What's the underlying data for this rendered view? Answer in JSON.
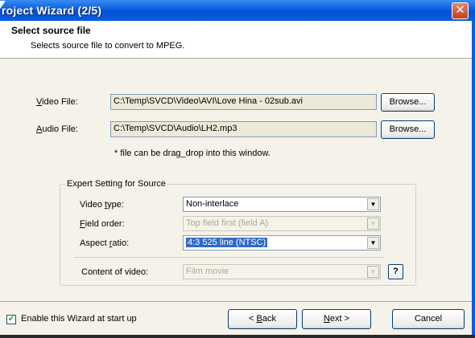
{
  "window": {
    "title": "roject Wizard (2/5)",
    "close_glyph": "✕"
  },
  "header": {
    "title": "Select source file",
    "subtitle": "Selects source file to convert to MPEG."
  },
  "video": {
    "label_key": "V",
    "label_rest": "ideo File:",
    "path": "C:\\Temp\\SVCD\\Video\\AVI\\Love Hina - 02sub.avi",
    "browse": "Browse..."
  },
  "audio": {
    "label_key": "A",
    "label_rest": "udio File:",
    "path": "C:\\Temp\\SVCD\\Audio\\LH2.mp3",
    "browse": "Browse..."
  },
  "note": "* file can be drag_drop into this window.",
  "expert": {
    "legend": "Expert Setting for Source",
    "video_type": {
      "label_pre": "Video ",
      "label_key": "t",
      "label_post": "ype:",
      "value": "Non-interlace"
    },
    "field_order": {
      "label_key": "F",
      "label_post": "ield order:",
      "value": "Top field first (field A)"
    },
    "aspect_ratio": {
      "label_pre": "Aspect ",
      "label_key": "r",
      "label_post": "atio:",
      "value": "4:3 525 line (NTSC)"
    },
    "content": {
      "label": "Content of video:",
      "value": "Film movie"
    },
    "help": "?"
  },
  "footer": {
    "checkbox_label": "Enable this Wizard at start up",
    "checkbox_checked": true,
    "check_glyph": "✔",
    "back_prefix": "< ",
    "back_key": "B",
    "back_rest": "ack",
    "next_key": "N",
    "next_rest": "ext >",
    "cancel": "Cancel"
  },
  "colors": {
    "titlebar": "#0a5ee0",
    "close": "#c4401b",
    "selection": "#316ac5"
  },
  "icons": {
    "close": "close-icon",
    "dropdown": "chevron-down-icon",
    "check": "checkmark-icon"
  }
}
